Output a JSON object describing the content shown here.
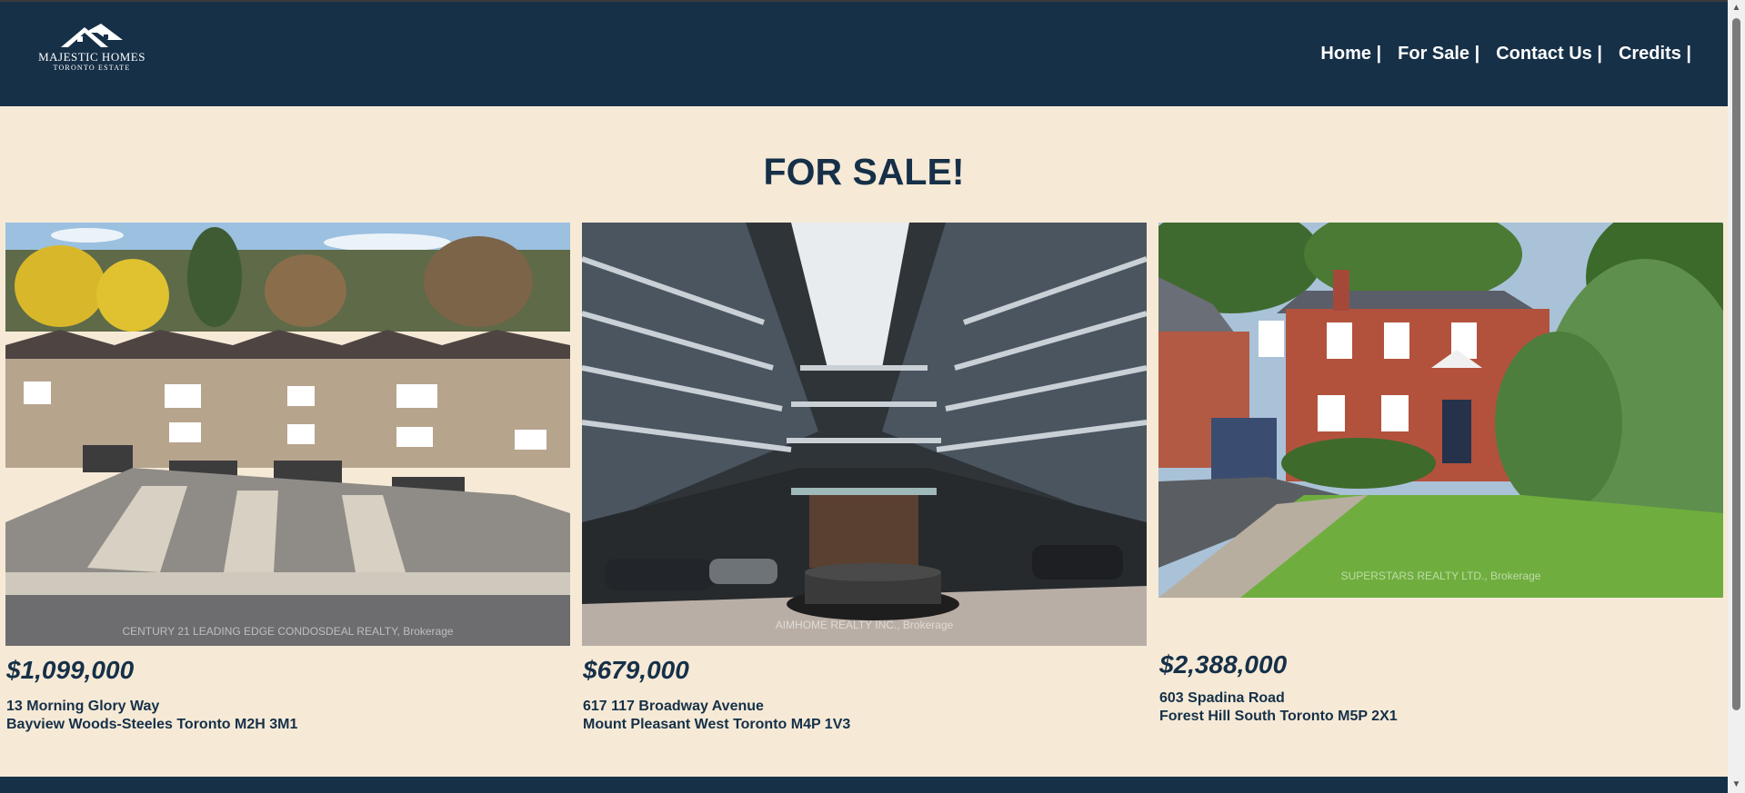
{
  "logo": {
    "name": "MAJESTIC HOMES",
    "subtitle": "TORONTO ESTATE"
  },
  "nav": [
    {
      "label": "Home |"
    },
    {
      "label": "For Sale |"
    },
    {
      "label": "Contact Us |"
    },
    {
      "label": "Credits |"
    }
  ],
  "page_title": "FOR SALE!",
  "listings": [
    {
      "price": "$1,099,000",
      "address_line1": "13 Morning Glory Way",
      "address_line2": "Bayview Woods-Steeles Toronto M2H 3M1",
      "watermark": "CENTURY 21 LEADING EDGE CONDOSDEAL REALTY, Brokerage"
    },
    {
      "price": "$679,000",
      "address_line1": "617 117 Broadway Avenue",
      "address_line2": "Mount Pleasant West Toronto M4P 1V3",
      "watermark": "AIMHOME REALTY INC., Brokerage"
    },
    {
      "price": "$2,388,000",
      "address_line1": "603 Spadina Road",
      "address_line2": "Forest Hill South Toronto M5P 2X1",
      "watermark": "SUPERSTARS REALTY LTD., Brokerage"
    }
  ],
  "colors": {
    "header": "#163048",
    "background": "#f6ead7",
    "text": "#163048"
  }
}
